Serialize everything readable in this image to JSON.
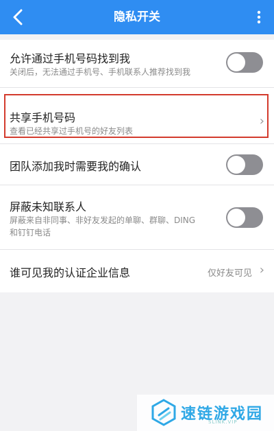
{
  "header": {
    "title": "隐私开关",
    "back_icon": "back-arrow-icon",
    "more_icon": "more-vertical-icon",
    "bar_color": "#2f8df2"
  },
  "settings": {
    "find_by_phone": {
      "title": "允许通过手机号码找到我",
      "subtitle": "关闭后，无法通过手机号、手机联系人推荐找到我",
      "enabled": false
    },
    "share_phone": {
      "title": "共享手机号码",
      "subtitle": "查看已经共享过手机号的好友列表"
    },
    "team_confirm": {
      "title": "团队添加我时需要我的确认",
      "enabled": false
    },
    "block_unknown": {
      "title": "屏蔽未知联系人",
      "subtitle_line1": "屏蔽来自非同事、非好友发起的单聊、群聊、DING",
      "subtitle_line2": "和钉钉电话",
      "enabled": false
    },
    "company_info_visibility": {
      "title": "谁可见我的认证企业信息",
      "value": "仅好友可见"
    }
  },
  "highlight_color": "#d33a2c",
  "watermark": {
    "name": "速链游戏园",
    "sub": "SLINK.VIP"
  }
}
